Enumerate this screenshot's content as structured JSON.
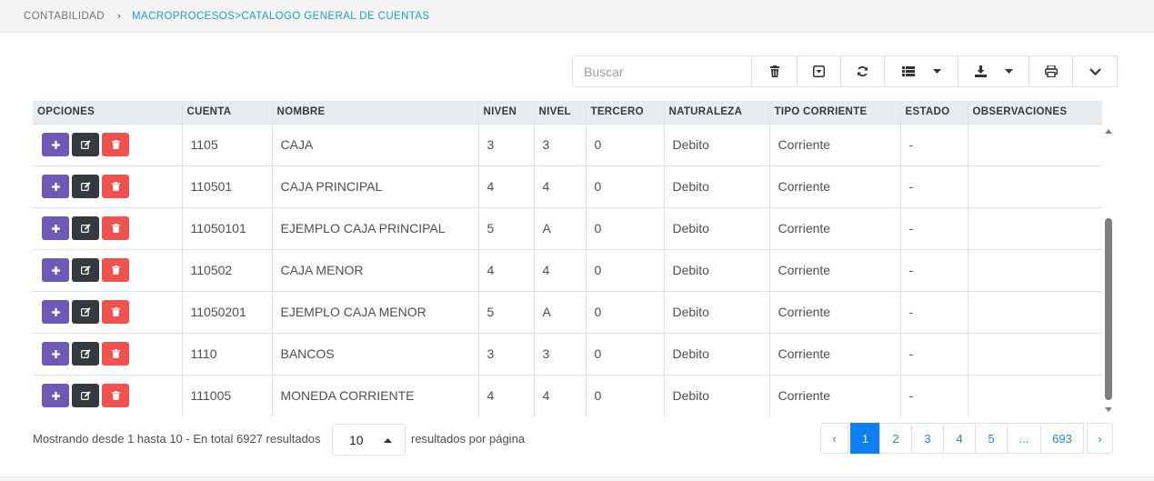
{
  "breadcrumb": {
    "root": "CONTABILIDAD",
    "separator": "›",
    "current": "MACROPROCESOS>CATALOGO GENERAL DE CUENTAS"
  },
  "toolbar": {
    "search_placeholder": "Buscar",
    "buttons": [
      "trash-icon",
      "toggle-icon",
      "refresh-icon",
      "list-icon",
      "download-icon",
      "print-icon",
      "chevron-down-icon"
    ]
  },
  "table": {
    "headers": [
      "OPCIONES",
      "CUENTA",
      "NOMBRE",
      "NIVEN",
      "NIVEL",
      "TERCERO",
      "NATURALEZA",
      "TIPO CORRIENTE",
      "ESTADO",
      "OBSERVACIONES"
    ],
    "rows": [
      {
        "cuenta": "1105",
        "nombre": "CAJA",
        "niven": "3",
        "nivel": "3",
        "tercero": "0",
        "naturaleza": "Debito",
        "tipo": "Corriente",
        "estado": "-",
        "obs": ""
      },
      {
        "cuenta": "110501",
        "nombre": "CAJA PRINCIPAL",
        "niven": "4",
        "nivel": "4",
        "tercero": "0",
        "naturaleza": "Debito",
        "tipo": "Corriente",
        "estado": "-",
        "obs": ""
      },
      {
        "cuenta": "11050101",
        "nombre": "EJEMPLO CAJA PRINCIPAL",
        "niven": "5",
        "nivel": "A",
        "tercero": "0",
        "naturaleza": "Debito",
        "tipo": "Corriente",
        "estado": "-",
        "obs": ""
      },
      {
        "cuenta": "110502",
        "nombre": "CAJA MENOR",
        "niven": "4",
        "nivel": "4",
        "tercero": "0",
        "naturaleza": "Debito",
        "tipo": "Corriente",
        "estado": "-",
        "obs": ""
      },
      {
        "cuenta": "11050201",
        "nombre": "EJEMPLO CAJA MENOR",
        "niven": "5",
        "nivel": "A",
        "tercero": "0",
        "naturaleza": "Debito",
        "tipo": "Corriente",
        "estado": "-",
        "obs": ""
      },
      {
        "cuenta": "1110",
        "nombre": "BANCOS",
        "niven": "3",
        "nivel": "3",
        "tercero": "0",
        "naturaleza": "Debito",
        "tipo": "Corriente",
        "estado": "-",
        "obs": ""
      },
      {
        "cuenta": "111005",
        "nombre": "MONEDA CORRIENTE",
        "niven": "4",
        "nivel": "4",
        "tercero": "0",
        "naturaleza": "Debito",
        "tipo": "Corriente",
        "estado": "-",
        "obs": ""
      }
    ]
  },
  "footer": {
    "showing": "Mostrando desde 1 hasta 10 - En total 6927 resultados",
    "per_page_value": "10",
    "per_page_label": "resultados por página"
  },
  "pagination": {
    "prev": "‹",
    "pages": [
      "1",
      "2",
      "3",
      "4",
      "5",
      "...",
      "693"
    ],
    "next": "›",
    "active": "1"
  },
  "colors": {
    "accent": "#1e9bd7",
    "add_button": "#6f59b6",
    "edit_button": "#343a40",
    "delete_button": "#f0524f",
    "page_active": "#0d7ff5"
  }
}
